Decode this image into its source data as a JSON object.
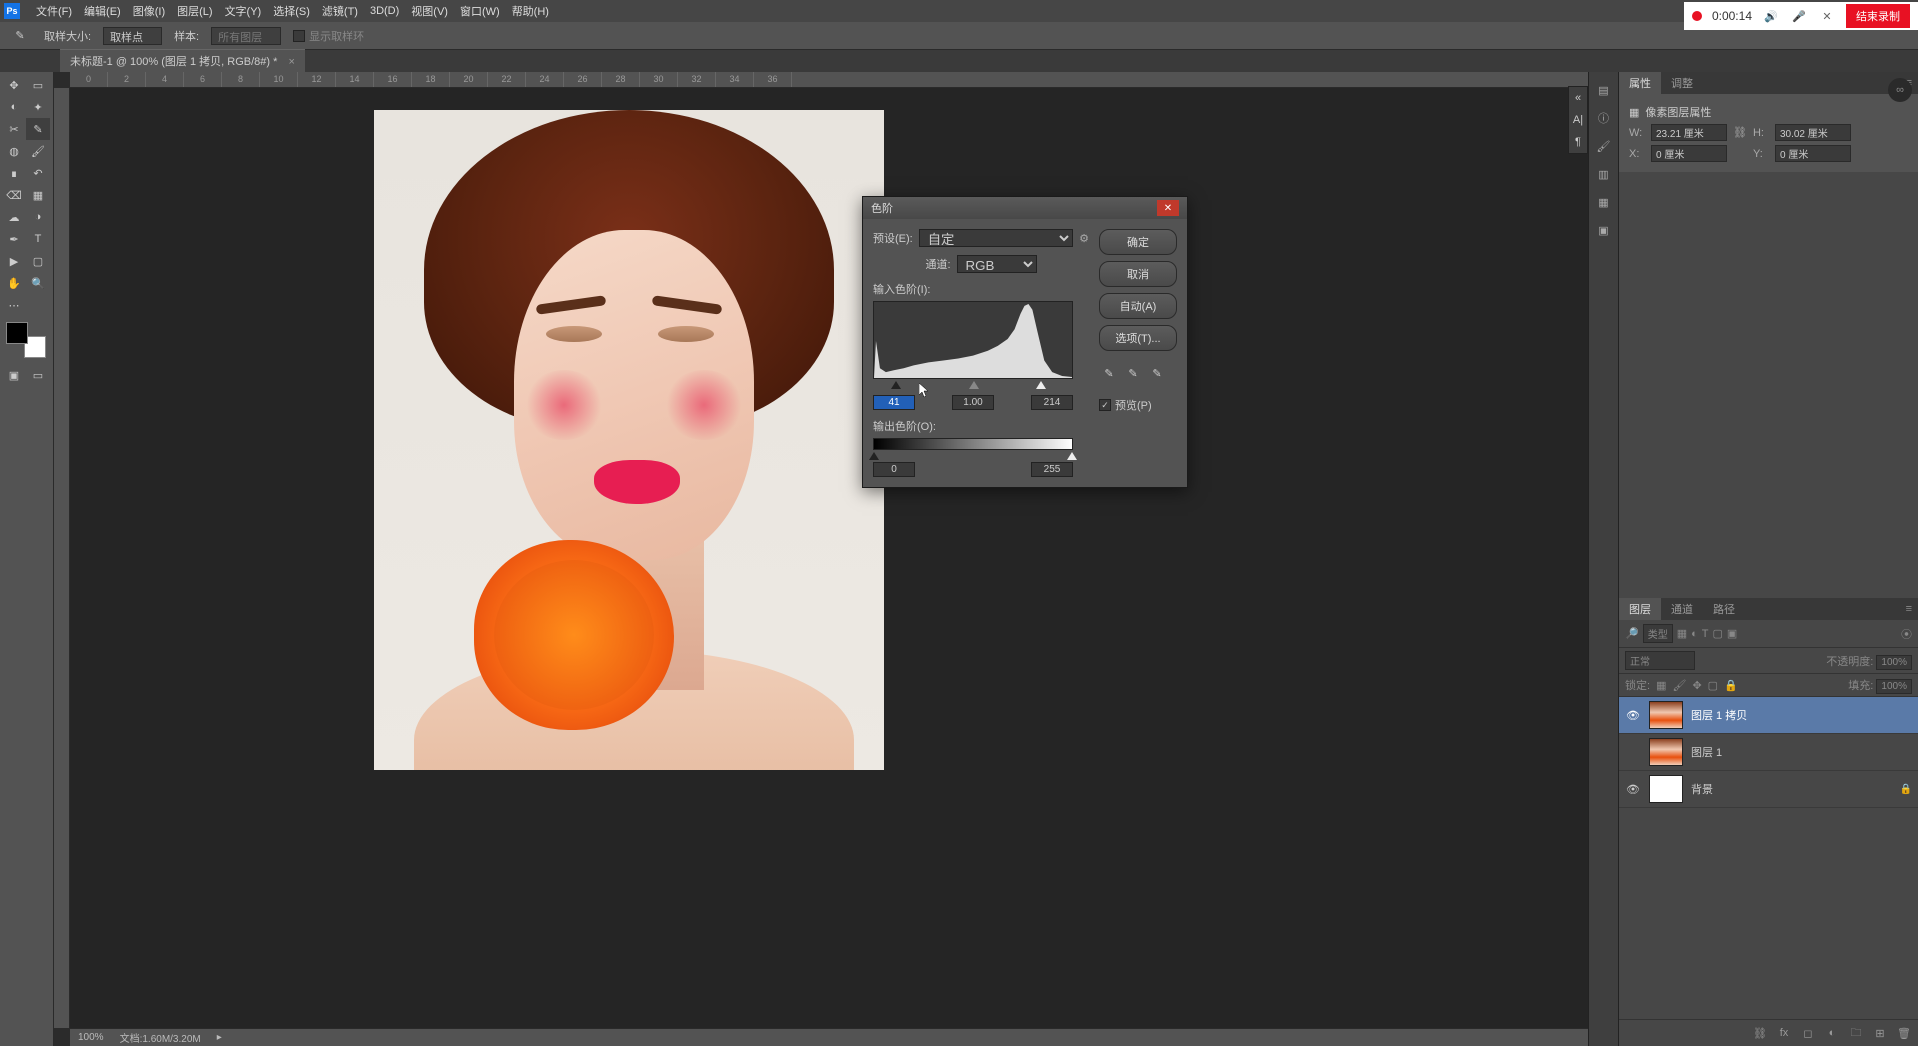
{
  "menubar": {
    "items": [
      "文件(F)",
      "编辑(E)",
      "图像(I)",
      "图层(L)",
      "文字(Y)",
      "选择(S)",
      "滤镜(T)",
      "3D(D)",
      "视图(V)",
      "窗口(W)",
      "帮助(H)"
    ]
  },
  "recording": {
    "time": "0:00:14",
    "stop_label": "结束录制"
  },
  "optionsbar": {
    "sample_size_label": "取样大小:",
    "sample_size_value": "取样点",
    "sample_label": "样本:",
    "sample_value": "所有图层",
    "show_ring": "显示取样环"
  },
  "document": {
    "tab_title": "未标题-1 @ 100% (图层 1 拷贝, RGB/8#) *"
  },
  "ruler_ticks": [
    "0",
    "2",
    "4",
    "6",
    "8",
    "10",
    "12",
    "14",
    "16",
    "18",
    "20",
    "22",
    "24",
    "26",
    "28",
    "30",
    "32",
    "34",
    "36"
  ],
  "statusbar": {
    "zoom": "100%",
    "docinfo": "文档:1.60M/3.20M"
  },
  "properties": {
    "tab_props": "属性",
    "tab_adjust": "调整",
    "title": "像素图层属性",
    "w_label": "W:",
    "w_value": "23.21 厘米",
    "h_label": "H:",
    "h_value": "30.02 厘米",
    "x_label": "X:",
    "x_value": "0 厘米",
    "y_label": "Y:",
    "y_value": "0 厘米"
  },
  "layers_panel": {
    "tab_layers": "图层",
    "tab_channels": "通道",
    "tab_paths": "路径",
    "kind_label": "类型",
    "blend_mode": "正常",
    "opacity_label": "不透明度:",
    "opacity_value": "100%",
    "lock_label": "锁定:",
    "fill_label": "填充:",
    "fill_value": "100%",
    "layers": [
      {
        "name": "图层 1 拷贝",
        "visible": true,
        "selected": true,
        "locked": false
      },
      {
        "name": "图层 1",
        "visible": false,
        "selected": false,
        "locked": false
      },
      {
        "name": "背景",
        "visible": true,
        "selected": false,
        "locked": true
      }
    ]
  },
  "levels_dialog": {
    "title": "色阶",
    "preset_label": "预设(E):",
    "preset_value": "自定",
    "channel_label": "通道:",
    "channel_value": "RGB",
    "input_label": "输入色阶(I):",
    "shadow_value": "41",
    "gamma_value": "1.00",
    "highlight_value": "214",
    "output_label": "输出色阶(O):",
    "output_low": "0",
    "output_high": "255",
    "ok": "确定",
    "cancel": "取消",
    "auto": "自动(A)",
    "options": "选项(T)...",
    "preview_label": "预览(P)"
  }
}
